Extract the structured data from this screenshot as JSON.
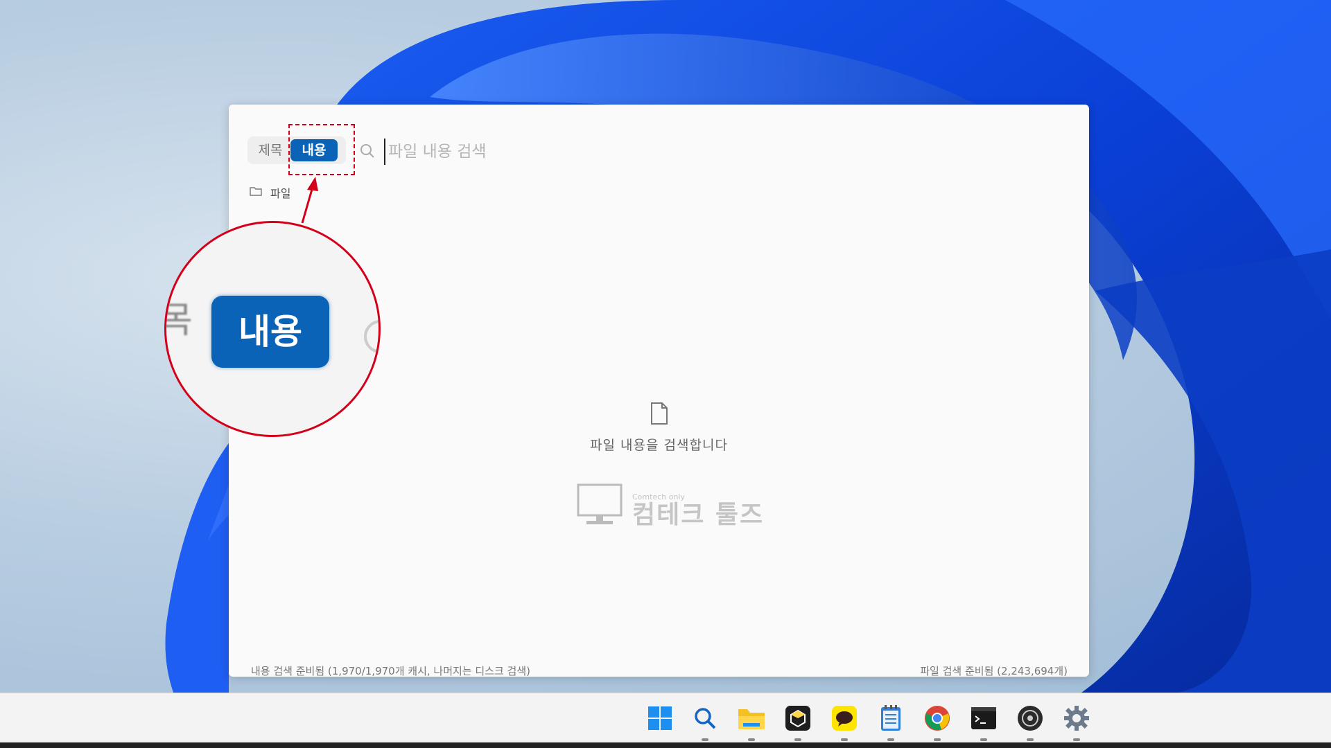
{
  "app": {
    "mode_title_label": "제목",
    "mode_content_label": "내용",
    "search_placeholder": "파일 내용 검색",
    "filter_label": "파일",
    "empty_message": "파일 내용을 검색합니다",
    "status_left": "내용 검색 준비됨 (1,970/1,970개 캐시, 나머지는 디스크 검색)",
    "status_right": "파일 검색 준비됨 (2,243,694개)"
  },
  "watermark": {
    "small": "Comtech only",
    "big": "컴테크 툴즈"
  },
  "callout": {
    "prev_fragment": "목",
    "zoomed_label": "내용"
  },
  "taskbar": {
    "icons": [
      "windows-start-icon",
      "search-icon",
      "file-explorer-icon",
      "app-cube-icon",
      "kakaotalk-icon",
      "notepad-icon",
      "chrome-icon",
      "terminal-icon",
      "photo-app-icon",
      "settings-icon"
    ]
  },
  "colors": {
    "accent": "#0b63b8",
    "annotation": "#d4001a"
  }
}
